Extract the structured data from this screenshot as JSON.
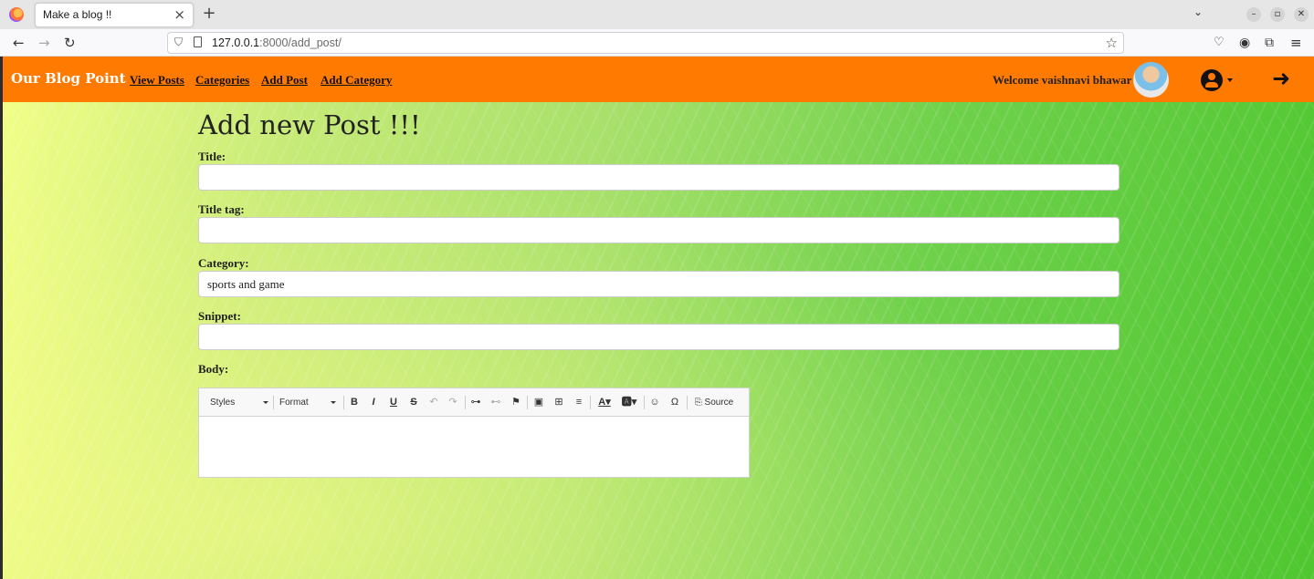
{
  "browser": {
    "tab_title": "Make a blog !!",
    "tab_close": "×",
    "new_tab": "+",
    "url_host": "127.0.0.1",
    "url_rest": ":8000/add_post/",
    "icons": [
      "firefox-icon",
      "back-icon",
      "forward-icon",
      "reload-icon",
      "shield-icon",
      "page-icon",
      "bookmark-star-icon",
      "pocket-icon",
      "account-icon",
      "extensions-icon",
      "menu-icon"
    ]
  },
  "site": {
    "brand": "Our Blog Point",
    "nav": [
      "View Posts",
      "Categories",
      "Add Post",
      "Add Category"
    ],
    "welcome": "Welcome vaishnavi bhawar",
    "accent": "#ff7a00"
  },
  "form": {
    "heading": "Add new Post !!!",
    "title_label": "Title:",
    "title_value": "",
    "title_tag_label": "Title tag:",
    "title_tag_value": "",
    "category_label": "Category:",
    "category_value": "sports and game",
    "snippet_label": "Snippet:",
    "snippet_value": "",
    "body_label": "Body:"
  },
  "editor": {
    "styles": "Styles",
    "format": "Format",
    "bold": "B",
    "italic": "I",
    "underline": "U",
    "strike": "S",
    "source": "Source"
  }
}
